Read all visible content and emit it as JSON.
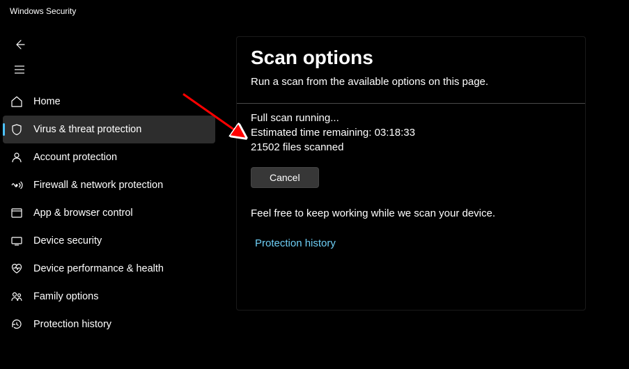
{
  "app_title": "Windows Security",
  "sidebar": {
    "items": [
      {
        "label": "Home"
      },
      {
        "label": "Virus & threat protection"
      },
      {
        "label": "Account protection"
      },
      {
        "label": "Firewall & network protection"
      },
      {
        "label": "App & browser control"
      },
      {
        "label": "Device security"
      },
      {
        "label": "Device performance & health"
      },
      {
        "label": "Family options"
      },
      {
        "label": "Protection history"
      }
    ]
  },
  "main": {
    "title": "Scan options",
    "subtitle": "Run a scan from the available options on this page.",
    "status": "Full scan running...",
    "time_remaining_label": "Estimated time remaining: ",
    "time_remaining_value": "03:18:33",
    "files_scanned_value": "21502",
    "files_scanned_suffix": " files scanned",
    "cancel_label": "Cancel",
    "info_text": "Feel free to keep working while we scan your device.",
    "link_text": "Protection history"
  }
}
